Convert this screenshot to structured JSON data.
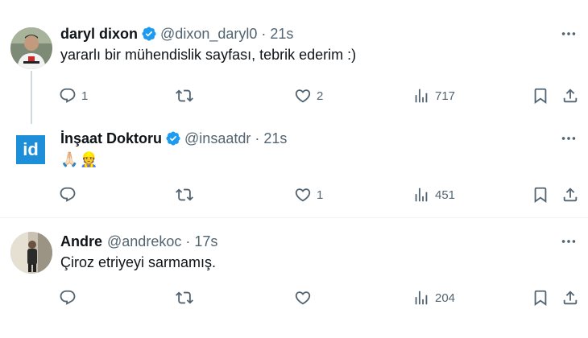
{
  "tweets": [
    {
      "name": "daryl dixon",
      "verified": true,
      "handle": "@dixon_daryl0",
      "dot": "·",
      "time": "21s",
      "text": "yararlı bir mühendislik sayfası, tebrik ederim :)",
      "replies": "1",
      "retweets": "",
      "likes": "2",
      "views": "717",
      "avatar_icon": "user-avatar-photo"
    },
    {
      "name": "İnşaat Doktoru",
      "verified": true,
      "handle": "@insaatdr",
      "dot": "·",
      "time": "21s",
      "text": "🙏🏻👷",
      "replies": "",
      "retweets": "",
      "likes": "1",
      "views": "451",
      "avatar_text": "id",
      "avatar_color": "#1d8fd8"
    },
    {
      "name": "Andre",
      "verified": false,
      "handle": "@andrekoc",
      "dot": "·",
      "time": "17s",
      "text": "Çiroz etriyeyi sarmamış.",
      "replies": "",
      "retweets": "",
      "likes": "",
      "views": "204",
      "avatar_icon": "user-avatar-photo"
    }
  ],
  "colors": {
    "text": "#0f1419",
    "muted": "#536471",
    "verified": "#1d9bf0",
    "divider": "#eff3f4"
  }
}
